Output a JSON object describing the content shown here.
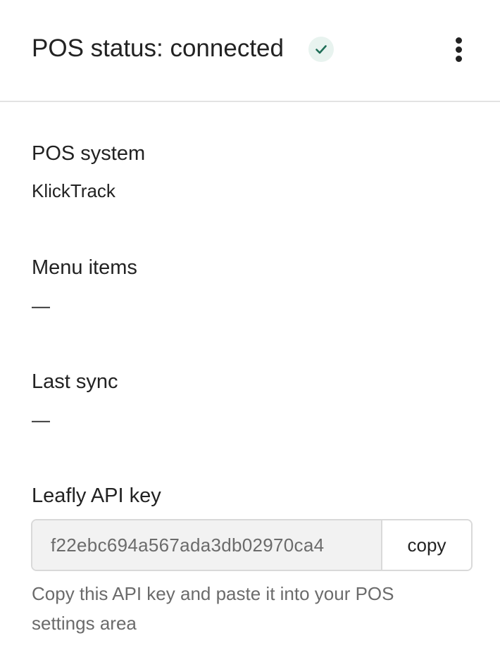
{
  "header": {
    "title": "POS status: connected",
    "status_icon": "check-icon",
    "menu_icon": "kebab-menu-icon"
  },
  "sections": {
    "pos_system": {
      "label": "POS system",
      "value": "KlickTrack"
    },
    "menu_items": {
      "label": "Menu items",
      "value": "—"
    },
    "last_sync": {
      "label": "Last sync",
      "value": "—"
    }
  },
  "api_key": {
    "label": "Leafly API key",
    "value": "f22ebc694a567ada3db02970ca4",
    "copy_label": "copy",
    "helper_text": "Copy this API key and paste it into your POS settings area"
  },
  "colors": {
    "accent_green": "#1f6e57",
    "badge_bg": "#e8f3ef",
    "muted_text": "#6b6b6b"
  }
}
